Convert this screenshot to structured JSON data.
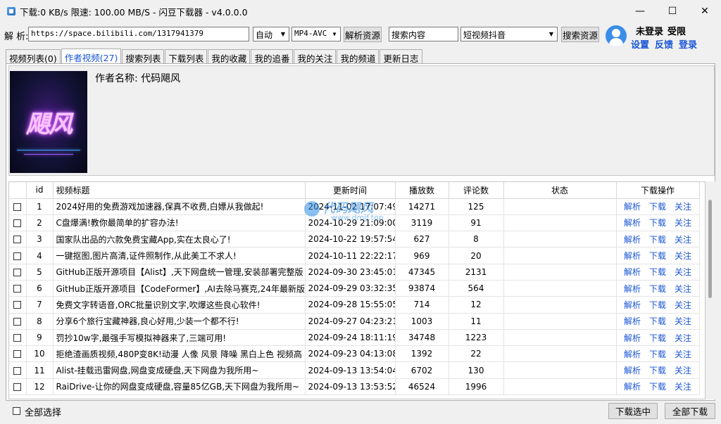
{
  "window": {
    "title": "下载:0 KB/s  限速: 100.00 MB/S  - 闪豆下载器 - v4.0.0.0",
    "min_glyph": "—",
    "max_glyph": "☐",
    "close_glyph": "✕"
  },
  "toolbar": {
    "parse_label": "解 析:",
    "url_value": "https://space.bilibili.com/1317941379",
    "quality_value": "自动",
    "format_value": "MP4-AVC",
    "parse_button": "解析资源",
    "search_placeholder": "搜索内容",
    "platform_value": "短视频抖音",
    "search_button": "搜索资源"
  },
  "user": {
    "status_left": "未登录",
    "status_right": "受限",
    "links": [
      "设置",
      "反馈",
      "登录"
    ]
  },
  "tabs": [
    {
      "label": "视频列表(0)"
    },
    {
      "label": "作者视频(27)"
    },
    {
      "label": "搜索列表"
    },
    {
      "label": "下载列表"
    },
    {
      "label": "我的收藏"
    },
    {
      "label": "我的追番"
    },
    {
      "label": "我的关注"
    },
    {
      "label": "我的频道"
    },
    {
      "label": "更新日志"
    }
  ],
  "author": {
    "name_label": "作者名称: 代码飓风",
    "logo_text": "飓风"
  },
  "table": {
    "columns": [
      "id",
      "视频标题",
      "更新时间",
      "播放数",
      "评论数",
      "状态",
      "下载操作"
    ],
    "actions": [
      "解析",
      "下载",
      "关注"
    ],
    "rows": [
      {
        "id": "1",
        "title": "2024好用的免费游戏加速器,保真不收费,白嫖从我做起!",
        "time": "2024-11-02 17:07:49",
        "plays": "14271",
        "comments": "125",
        "status": ""
      },
      {
        "id": "2",
        "title": "C盘爆满!教你最简单的扩容办法!",
        "time": "2024-10-29 21:09:00",
        "plays": "3119",
        "comments": "91",
        "status": ""
      },
      {
        "id": "3",
        "title": "国家队出品的六款免费宝藏App,实在太良心了!",
        "time": "2024-10-22 19:57:54",
        "plays": "627",
        "comments": "8",
        "status": ""
      },
      {
        "id": "4",
        "title": "一键抠图,图片高清,证件照制作,从此美工不求人!",
        "time": "2024-10-11 22:22:17",
        "plays": "969",
        "comments": "20",
        "status": ""
      },
      {
        "id": "5",
        "title": "GitHub正版开源项目【Alist】,天下网盘统一管理,安装部署完整版",
        "time": "2024-09-30 23:45:01",
        "plays": "47345",
        "comments": "2131",
        "status": ""
      },
      {
        "id": "6",
        "title": "GitHub正版开源项目【CodeFormer】,AI去除马赛克,24年最新版",
        "time": "2024-09-29 03:32:35",
        "plays": "93874",
        "comments": "564",
        "status": ""
      },
      {
        "id": "7",
        "title": "免费文字转语音,ORC批量识别文字,吹爆这些良心软件!",
        "time": "2024-09-28 15:55:05",
        "plays": "714",
        "comments": "12",
        "status": ""
      },
      {
        "id": "8",
        "title": "分享6个旅行宝藏神器,良心好用,少装一个都不行!",
        "time": "2024-09-27 04:23:21",
        "plays": "1003",
        "comments": "11",
        "status": ""
      },
      {
        "id": "9",
        "title": "罚抄10w字,最强手写模拟神器来了,三端可用!",
        "time": "2024-09-24 18:11:19",
        "plays": "34748",
        "comments": "1223",
        "status": ""
      },
      {
        "id": "10",
        "title": "拒绝渣画质视频,480P变8K!动漫 人像 风景 降噪 黑白上色 视频高",
        "time": "2024-09-23 04:13:08",
        "plays": "1392",
        "comments": "22",
        "status": ""
      },
      {
        "id": "11",
        "title": "Alist-挂载迅雷网盘,网盘变成硬盘,天下网盘为我所用~",
        "time": "2024-09-13 13:54:04",
        "plays": "6702",
        "comments": "130",
        "status": ""
      },
      {
        "id": "12",
        "title": "RaiDrive-让你的网盘变成硬盘,容量85亿GB,天下网盘为我所用~",
        "time": "2024-09-13 13:53:52",
        "plays": "46524",
        "comments": "1996",
        "status": ""
      }
    ]
  },
  "watermark": {
    "line1": "代码飓风",
    "line2": "www.dmjf.top"
  },
  "footer": {
    "select_all": "全部选择",
    "download_selected": "下载选中",
    "download_all": "全部下载"
  },
  "colors": {
    "link": "#1a56d6",
    "avatar": "#3b8de8"
  }
}
